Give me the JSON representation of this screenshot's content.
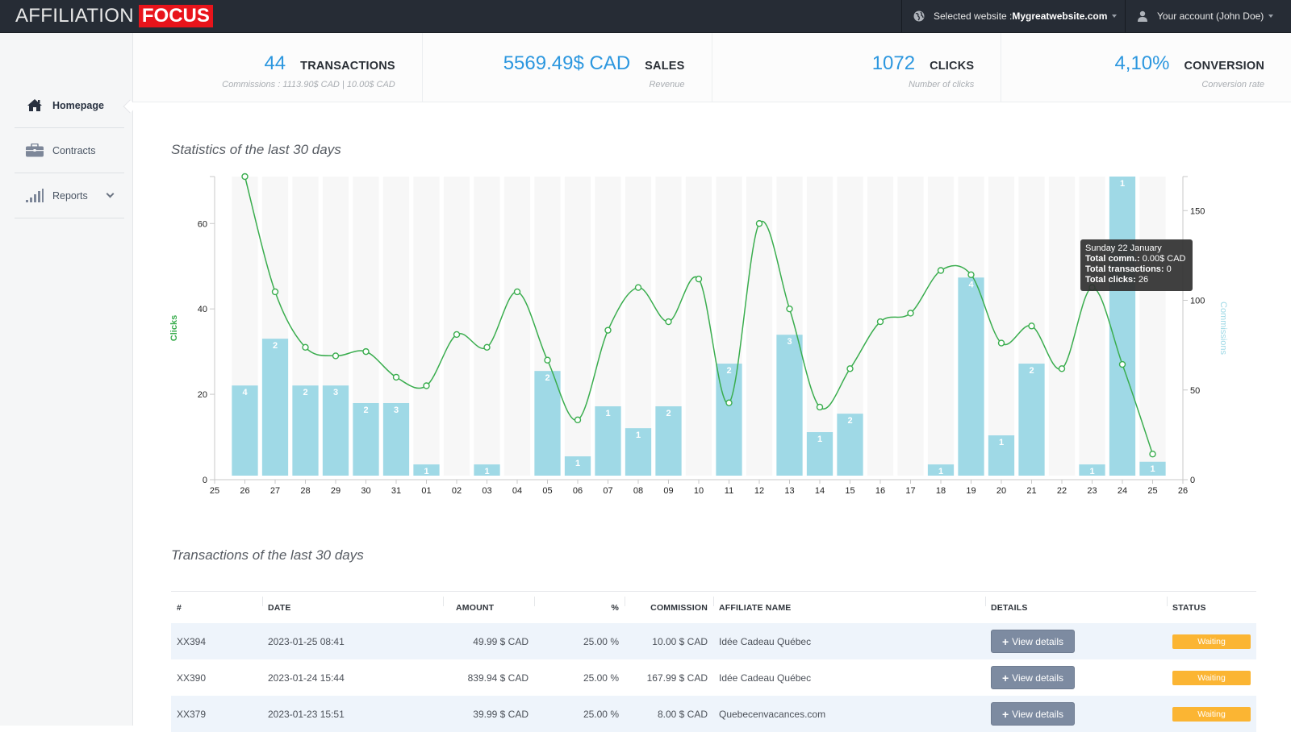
{
  "app": {
    "logo_light": "AFFILIATION",
    "logo_bold": "FOCUS"
  },
  "topbar": {
    "site_prefix": "Selected website : ",
    "site_name": "Mygreatwebsite.com",
    "account_label": "Your account (John Doe)",
    "site_icon": "globe-icon",
    "account_icon": "user-icon"
  },
  "sidebar": {
    "items": [
      {
        "label": "Homepage",
        "icon": "home-icon",
        "active": true
      },
      {
        "label": "Contracts",
        "icon": "briefcase-icon",
        "active": false
      },
      {
        "label": "Reports",
        "icon": "signal-bars-icon",
        "active": false,
        "expandable": true
      }
    ]
  },
  "stats": [
    {
      "value": "44",
      "label": "TRANSACTIONS",
      "sub": "Commissions : 1113.90$ CAD | 10.00$ CAD"
    },
    {
      "value": "5569.49$ CAD",
      "label": "SALES",
      "sub": "Revenue"
    },
    {
      "value": "1072",
      "label": "CLICKS",
      "sub": "Number of clicks"
    },
    {
      "value": "4,10%",
      "label": "CONVERSION",
      "sub": "Conversion rate"
    }
  ],
  "statistics_title": "Statistics of the last 30 days",
  "chart_data": {
    "type": "bar+line",
    "title": "Statistics of the last 30 days",
    "x_ticks": [
      "25",
      "26",
      "27",
      "28",
      "29",
      "30",
      "31",
      "01",
      "02",
      "03",
      "04",
      "05",
      "06",
      "07",
      "08",
      "09",
      "10",
      "11",
      "12",
      "13",
      "14",
      "15",
      "16",
      "17",
      "18",
      "19",
      "20",
      "21",
      "22",
      "23",
      "24",
      "25",
      "26"
    ],
    "categories": [
      "26",
      "27",
      "28",
      "29",
      "30",
      "31",
      "01",
      "02",
      "03",
      "04",
      "05",
      "06",
      "07",
      "08",
      "09",
      "10",
      "11",
      "12",
      "13",
      "14",
      "15",
      "16",
      "17",
      "18",
      "19",
      "20",
      "21",
      "22",
      "23",
      "24",
      "25"
    ],
    "series": [
      {
        "name": "Commissions",
        "type": "bar",
        "axis": "right",
        "color": "#9fd9e6",
        "values": [
          52.5,
          78.6,
          52.5,
          52.5,
          42.7,
          42.7,
          8.5,
          0,
          8.5,
          0,
          60.6,
          13,
          40.9,
          28.7,
          40.9,
          0,
          64.7,
          0,
          80.8,
          26.5,
          36.8,
          0,
          0,
          8.5,
          112.7,
          24.7,
          64.7,
          0,
          8.5,
          169,
          10
        ],
        "labels": [
          "4",
          "2",
          "2",
          "3",
          "2",
          "3",
          "1",
          "",
          "1",
          "",
          "2",
          "1",
          "1",
          "1",
          "2",
          "",
          "2",
          "",
          "3",
          "1",
          "2",
          "",
          "",
          "1",
          "4",
          "1",
          "2",
          "",
          "1",
          "1",
          "1"
        ]
      },
      {
        "name": "Clicks",
        "type": "line",
        "axis": "left",
        "color": "#3aad4e",
        "values": [
          71,
          44,
          31,
          29,
          30,
          24,
          22,
          34,
          31,
          44,
          28,
          14,
          35,
          45,
          37,
          47,
          18,
          60,
          40,
          17,
          26,
          37,
          39,
          49,
          48,
          32,
          36,
          26,
          45,
          27,
          6
        ]
      }
    ],
    "ylabel_left": "Clicks",
    "ylabel_right": "Commissions",
    "ylim_left": [
      0,
      71
    ],
    "ylim_right": [
      0,
      169
    ],
    "yticks_left": [
      0,
      20,
      40,
      60
    ],
    "yticks_right": [
      0,
      50,
      100,
      150
    ],
    "tooltip": {
      "title": "Sunday 22 January",
      "lines": [
        {
          "key": "Total comm.:",
          "value": " 0.00$ CAD"
        },
        {
          "key": "Total transactions:",
          "value": " 0"
        },
        {
          "key": "Total clicks:",
          "value": " 26"
        }
      ]
    }
  },
  "transactions_title": "Transactions of the last 30 days",
  "table": {
    "columns": [
      "#",
      "DATE",
      "AMOUNT",
      "%",
      "COMMISSION",
      "AFFILIATE NAME",
      "DETAILS",
      "STATUS"
    ],
    "rows": [
      {
        "id": "XX394",
        "date": "2023-01-25 08:41",
        "amount": "49.99 $ CAD",
        "pct": "25.00 %",
        "commission": "10.00 $ CAD",
        "affiliate": "Idée Cadeau Québec",
        "details": "View details",
        "status": "Waiting"
      },
      {
        "id": "XX390",
        "date": "2023-01-24 15:44",
        "amount": "839.94 $ CAD",
        "pct": "25.00 %",
        "commission": "167.99 $ CAD",
        "affiliate": "Idée Cadeau Québec",
        "details": "View details",
        "status": "Waiting"
      },
      {
        "id": "XX379",
        "date": "2023-01-23 15:51",
        "amount": "39.99 $ CAD",
        "pct": "25.00 %",
        "commission": "8.00 $ CAD",
        "affiliate": "Quebecenvacances.com",
        "details": "View details",
        "status": "Waiting"
      }
    ]
  },
  "colors": {
    "accent": "#2c97df",
    "bar": "#9fd9e6",
    "line": "#3aad4e",
    "status_waiting": "#fbb533",
    "brand_red": "#e8141b"
  }
}
